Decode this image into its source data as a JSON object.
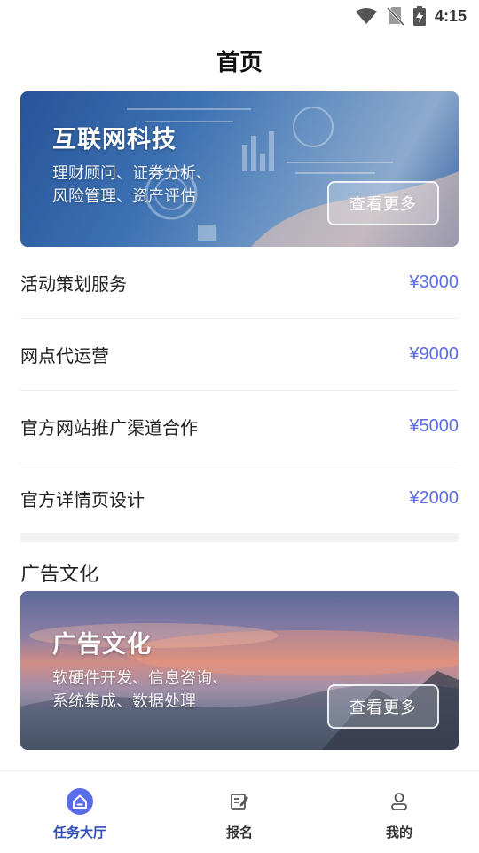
{
  "status_bar": {
    "time": "4:15",
    "icons": [
      "wifi-icon",
      "no-sim-icon",
      "battery-charging-icon"
    ]
  },
  "page": {
    "title": "首页"
  },
  "banner_tech": {
    "title": "互联网科技",
    "subtitle_line1": "理财顾问、证券分析、",
    "subtitle_line2": "风险管理、资产评估",
    "button": "查看更多"
  },
  "services": [
    {
      "name": "活动策划服务",
      "price": "¥3000"
    },
    {
      "name": "网点代运营",
      "price": "¥9000"
    },
    {
      "name": "官方网站推广渠道合作",
      "price": "¥5000"
    },
    {
      "name": "官方详情页设计",
      "price": "¥2000"
    }
  ],
  "section": {
    "title": "广告文化"
  },
  "banner_ad": {
    "title": "广告文化",
    "subtitle_line1": "软硬件开发、信息咨询、",
    "subtitle_line2": "系统集成、数据处理",
    "button": "查看更多"
  },
  "bottom_nav": [
    {
      "label": "任务大厅",
      "icon": "home-icon",
      "active": true
    },
    {
      "label": "报名",
      "icon": "edit-icon",
      "active": false
    },
    {
      "label": "我的",
      "icon": "user-icon",
      "active": false
    }
  ],
  "colors": {
    "accent": "#5b6ce8",
    "nav_active": "#2f4fb6",
    "nav_icon_active_bg": "#5b6ce8"
  }
}
